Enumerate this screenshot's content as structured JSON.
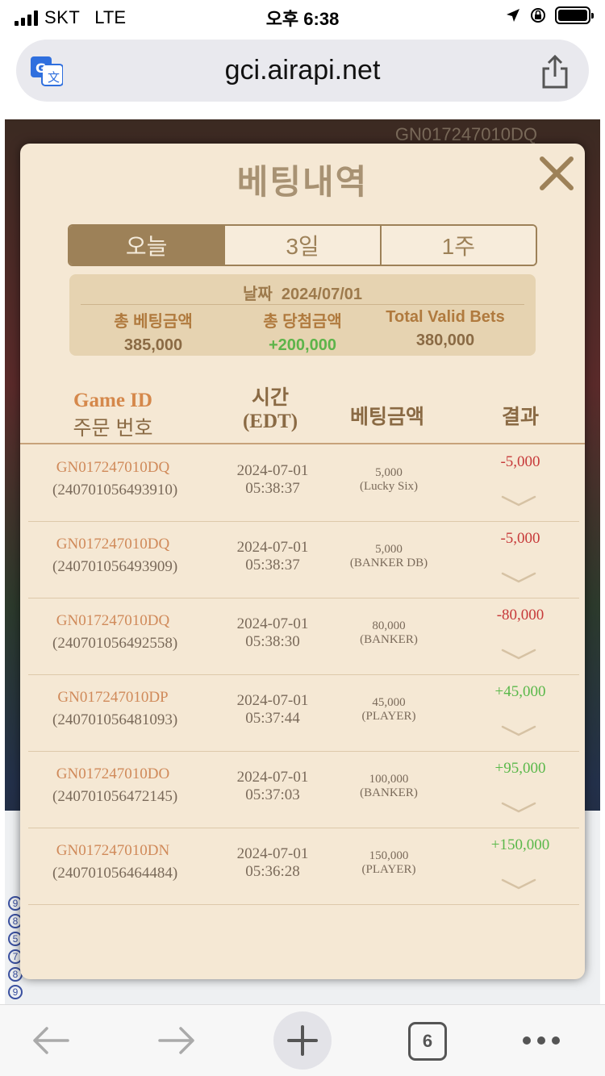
{
  "status_bar": {
    "carrier": "SKT",
    "network": "LTE",
    "time": "오후 6:38"
  },
  "browser": {
    "url": "gci.airapi.net",
    "open_tabs": "6"
  },
  "background": {
    "game_id_overlay": "GN017247010DQ"
  },
  "modal": {
    "title": "베팅내역",
    "tabs": [
      {
        "label": "오늘",
        "active": true
      },
      {
        "label": "3일",
        "active": false
      },
      {
        "label": "1주",
        "active": false
      }
    ],
    "summary": {
      "date_label": "날짜",
      "date": "2024/07/01",
      "total_bet_label": "총 베팅금액",
      "total_bet": "385,000",
      "total_win_label": "총 당첨금액",
      "total_win": "+200,000",
      "total_valid_label": "Total Valid Bets",
      "total_valid": "380,000"
    },
    "table": {
      "headers": {
        "game_id": "Game ID",
        "order_no": "주문 번호",
        "time": "시간",
        "time_zone": "(EDT)",
        "amount": "베팅금액",
        "result": "결과"
      },
      "rows": [
        {
          "game_id": "GN017247010DQ",
          "order_no": "(240701056493910)",
          "date": "2024-07-01",
          "time": "05:38:37",
          "amount": "5,000",
          "bet_type": "(Lucky Six)",
          "result": "-5,000",
          "result_type": "loss"
        },
        {
          "game_id": "GN017247010DQ",
          "order_no": "(240701056493909)",
          "date": "2024-07-01",
          "time": "05:38:37",
          "amount": "5,000",
          "bet_type": "(BANKER DB)",
          "result": "-5,000",
          "result_type": "loss"
        },
        {
          "game_id": "GN017247010DQ",
          "order_no": "(240701056492558)",
          "date": "2024-07-01",
          "time": "05:38:30",
          "amount": "80,000",
          "bet_type": "(BANKER)",
          "result": "-80,000",
          "result_type": "loss"
        },
        {
          "game_id": "GN017247010DP",
          "order_no": "(240701056481093)",
          "date": "2024-07-01",
          "time": "05:37:44",
          "amount": "45,000",
          "bet_type": "(PLAYER)",
          "result": "+45,000",
          "result_type": "gain"
        },
        {
          "game_id": "GN017247010DO",
          "order_no": "(240701056472145)",
          "date": "2024-07-01",
          "time": "05:37:03",
          "amount": "100,000",
          "bet_type": "(BANKER)",
          "result": "+95,000",
          "result_type": "gain"
        },
        {
          "game_id": "GN017247010DN",
          "order_no": "(240701056464484)",
          "date": "2024-07-01",
          "time": "05:36:28",
          "amount": "150,000",
          "bet_type": "(PLAYER)",
          "result": "+150,000",
          "result_type": "gain"
        }
      ]
    }
  },
  "colors": {
    "modal_bg": "#f5e8d4",
    "accent": "#9d8158",
    "loss": "#c73a3a",
    "gain": "#5ab84a"
  }
}
